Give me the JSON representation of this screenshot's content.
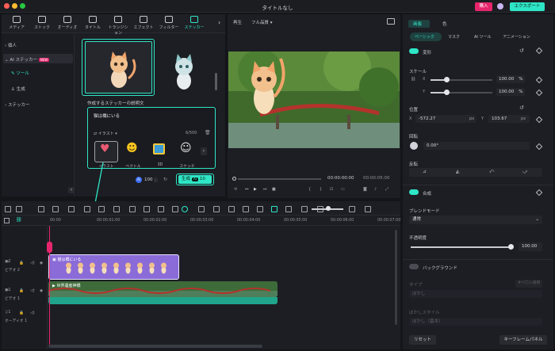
{
  "window": {
    "title": "タイトルなし",
    "buy": "購入",
    "export": "エクスポート"
  },
  "toolbar": [
    {
      "label": "メディア",
      "icon": "media-icon"
    },
    {
      "label": "ストック",
      "icon": "stock-icon"
    },
    {
      "label": "オーディオ",
      "icon": "audio-icon"
    },
    {
      "label": "タイトル",
      "icon": "title-icon"
    },
    {
      "label": "トランジション",
      "icon": "transition-icon"
    },
    {
      "label": "エフェクト",
      "icon": "effect-icon"
    },
    {
      "label": "フィルター",
      "icon": "filter-icon"
    },
    {
      "label": "ステッカー",
      "icon": "sticker-icon"
    }
  ],
  "sidebar": {
    "personal": "個人",
    "ai_sticker": "AI ステッカー",
    "new_badge": "NEW",
    "tool": "ツール",
    "generate": "生成",
    "sticker": "ステッカー"
  },
  "sticker_panel": {
    "desc_label": "作成するステッカーの説明文",
    "prompt": "猫は橋にいる",
    "style_select": "イラスト",
    "char_count": "6/500",
    "styles": [
      "イラスト",
      "ベクトル",
      "3D",
      "スケッチ"
    ],
    "credits": "100",
    "generate_label": "生成",
    "generate_cost": "10"
  },
  "preview": {
    "play_label": "再生",
    "quality": "フル品質",
    "time_current": "00:00:00:00",
    "time_total": "00:00:05:00"
  },
  "props": {
    "tabs": [
      "画像",
      "色"
    ],
    "subtabs": [
      "ベーシック",
      "マスク",
      "AI ツール",
      "アニメーション"
    ],
    "transform": "変形",
    "scale": "スケール",
    "x_label": "X",
    "y_label": "Y",
    "scale_x": "100.00",
    "scale_y": "100.00",
    "percent": "%",
    "position": "位置",
    "pos_x": "-572.27",
    "pos_y": "103.67",
    "px": "px",
    "rotate": "回転",
    "rotate_val": "0.00°",
    "flip": "反転",
    "composite": "合成",
    "blend_mode": "ブレンドモード",
    "blend_value": "通常",
    "opacity": "不透明度",
    "opacity_val": "100.00",
    "background": "バックグラウンド",
    "type": "タイプ",
    "type_btn": "すべてに適用",
    "type_value": "ぼかし",
    "blur_style": "ぼかしスタイル",
    "blur_value": "ぼかし（基本）",
    "reset": "リセット",
    "keyframe": "キーフレームパネル"
  },
  "timeline": {
    "times": [
      "00:00",
      "00:00:01:00",
      "00:00:02:00",
      "00:00:03:00",
      "00:00:04:00",
      "00:00:05:00",
      "00:00:06:00",
      "00:00:07:00"
    ],
    "tracks": [
      "ビデオ 2",
      "ビデオ 1",
      "オーディオ 1"
    ],
    "track_nums": [
      "2",
      "1",
      "1"
    ],
    "clip_sticker": "猫は橋にいる",
    "clip_video": "世界遺産神橋"
  },
  "colors": {
    "accent": "#2ee6c6",
    "buy": "#e7256d",
    "sticker_clip": "#8a6bd8",
    "video_clip": "#1fa58c"
  }
}
